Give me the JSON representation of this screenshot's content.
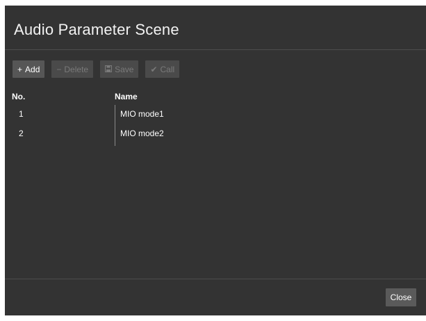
{
  "dialog": {
    "title": "Audio Parameter Scene"
  },
  "toolbar": {
    "add": {
      "label": "Add",
      "icon": "plus-icon",
      "glyph": "+",
      "enabled": true
    },
    "delete": {
      "label": "Delete",
      "icon": "minus-icon",
      "glyph": "−",
      "enabled": false
    },
    "save": {
      "label": "Save",
      "icon": "floppy-disk-icon",
      "glyph": "🖫",
      "enabled": false
    },
    "call": {
      "label": "Call",
      "icon": "checkmark-icon",
      "glyph": "✔",
      "enabled": false
    }
  },
  "table": {
    "columns": [
      "No.",
      "Name"
    ],
    "rows": [
      {
        "no": "1",
        "name": "MIO mode1"
      },
      {
        "no": "2",
        "name": "MIO mode2"
      }
    ]
  },
  "footer": {
    "close_label": "Close"
  },
  "colors": {
    "dialog_bg": "#333333",
    "button_enabled": "#565656",
    "button_disabled": "#4a4a4a",
    "disabled_text": "#7a7a7a"
  }
}
